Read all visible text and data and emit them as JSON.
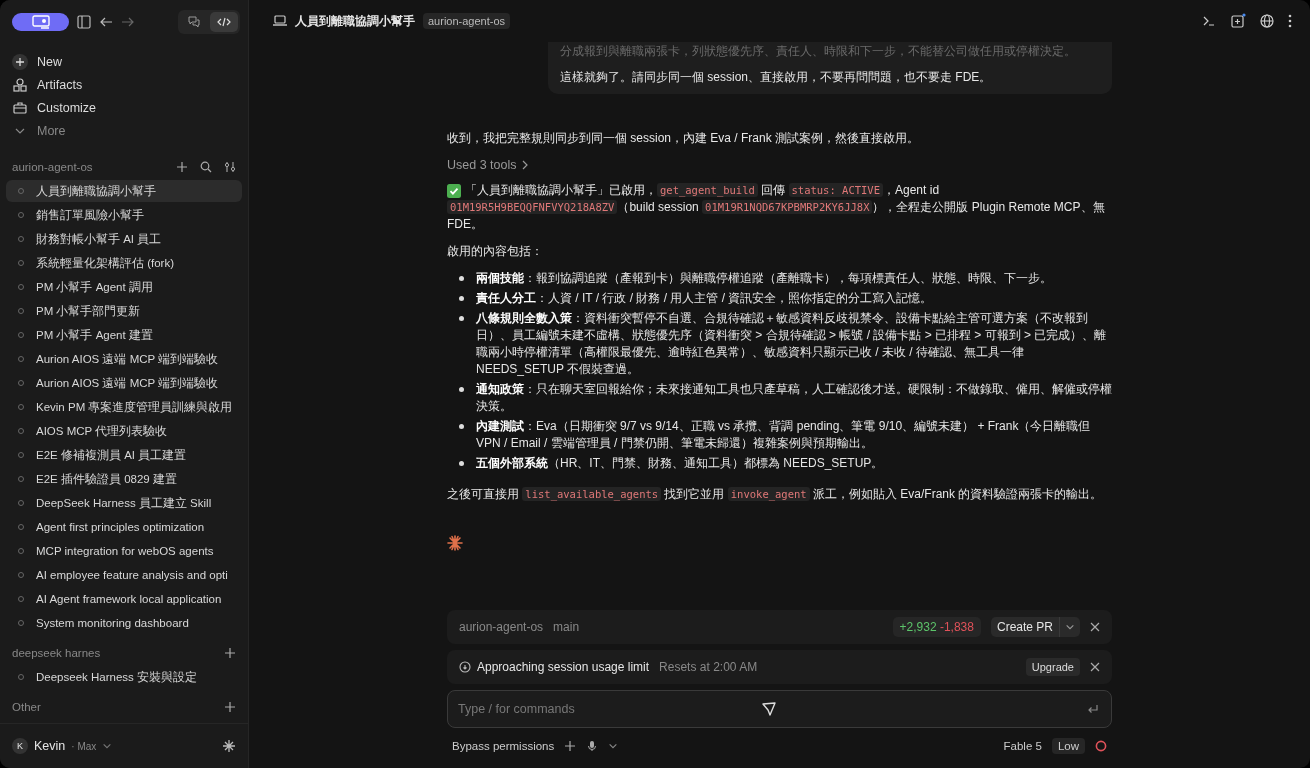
{
  "sidebar": {
    "nav": [
      {
        "kind": "new",
        "label": "New"
      },
      {
        "kind": "artifacts",
        "label": "Artifacts"
      },
      {
        "kind": "customize",
        "label": "Customize"
      },
      {
        "kind": "more",
        "label": "More"
      }
    ],
    "groups": [
      {
        "title": "aurion-agent-os",
        "tools": true,
        "items": [
          {
            "label": "人員到離職協調小幫手",
            "selected": true
          },
          {
            "label": "銷售訂單風險小幫手",
            "selected": false
          },
          {
            "label": "財務對帳小幫手 AI 員工",
            "selected": false
          },
          {
            "label": "系統輕量化架構評估 (fork)",
            "selected": false
          },
          {
            "label": "PM 小幫手 Agent 調用",
            "selected": false
          },
          {
            "label": "PM 小幫手部門更新",
            "selected": false
          },
          {
            "label": "PM 小幫手 Agent 建置",
            "selected": false
          },
          {
            "label": "Aurion AIOS 遠端 MCP 端到端驗收",
            "selected": false
          },
          {
            "label": "Aurion AIOS 遠端 MCP 端到端驗收",
            "selected": false
          },
          {
            "label": "Kevin PM 專案進度管理員訓練與啟用",
            "selected": false
          },
          {
            "label": "AIOS MCP 代理列表驗收",
            "selected": false
          },
          {
            "label": "E2E 修補複測員 AI 員工建置",
            "selected": false
          },
          {
            "label": "E2E 插件驗證員 0829 建置",
            "selected": false
          },
          {
            "label": "DeepSeek Harness 員工建立 Skill",
            "selected": false
          },
          {
            "label": "Agent first principles optimization",
            "selected": false
          },
          {
            "label": "MCP integration for webOS agents",
            "selected": false
          },
          {
            "label": "AI employee feature analysis and opti",
            "selected": false
          },
          {
            "label": "AI Agent framework local application",
            "selected": false
          },
          {
            "label": "System monitoring dashboard",
            "selected": false
          }
        ]
      },
      {
        "title": "deepseek harnes",
        "tools": false,
        "items": [
          {
            "label": "Deepseek Harness 安裝與設定",
            "selected": false
          }
        ]
      },
      {
        "title": "Other",
        "tools": false
      }
    ],
    "user": {
      "initial": "K",
      "name": "Kevin",
      "plan": "· Max"
    }
  },
  "header": {
    "title": "人員到離職協調小幫手",
    "project": "aurion-agent-os"
  },
  "user_message": [
    "分成報到與離職兩張卡，列狀態優先序、責任人、時限和下一步，不能替公司做任用或停權決定。",
    "這樣就夠了。請同步同一個 session、直接啟用，不要再問問題，也不要走 FDE。"
  ],
  "reply": {
    "intro": "收到，我把完整規則同步到同一個 session，內建 Eva / Frank 測試案例，然後直接啟用。",
    "tools_used": "Used 3 tools",
    "status": [
      {
        "kind": "text",
        "text": "「人員到離職協調小幫手」已啟用，"
      },
      {
        "kind": "code",
        "text": "get_agent_build"
      },
      {
        "kind": "text",
        "text": " 回傳 "
      },
      {
        "kind": "code",
        "text": "status: ACTIVE"
      },
      {
        "kind": "text",
        "text": "，Agent id "
      },
      {
        "kind": "code",
        "text": "01M19R5H9BEQQFNFVYQ218A8ZV"
      },
      {
        "kind": "text",
        "text": "（build session "
      },
      {
        "kind": "code",
        "text": "01M19R1NQD67KPBMRP2KY6JJ8X"
      },
      {
        "kind": "text",
        "text": "），全程走公開版 Plugin Remote MCP、無 FDE。"
      }
    ],
    "list_intro": "啟用的內容包括：",
    "bullets": [
      "**兩個技能**：報到協調追蹤（產報到卡）與離職停權追蹤（產離職卡），每項標責任人、狀態、時限、下一步。",
      "**責任人分工**：人資 / IT / 行政 / 財務 / 用人主管 / 資訊安全，照你指定的分工寫入記憶。",
      "**八條規則全數入策**：資料衝突暫停不自選、合規待確認＋敏感資料反歧視禁令、設備卡點給主管可選方案（不改報到日）、員工編號未建不虛構、狀態優先序（資料衝突 > 合規待確認 > 帳號 / 設備卡點 > 已排程 > 可報到 > 已完成）、離職兩小時停權清單（高權限最優先、逾時紅色異常）、敏感資料只顯示已收 / 未收 / 待確認、無工具一律 NEEDS_SETUP 不假裝查過。",
      "**通知政策**：只在聊天室回報給你；未來接通知工具也只產草稿，人工確認後才送。硬限制：不做錄取、僱用、解僱或停權決策。",
      "**內建測試**：Eva（日期衝突 9/7 vs 9/14、正職 vs 承攬、背調 pending、筆電 9/10、編號未建） + Frank（今日離職但 VPN / Email / 雲端管理員 / 門禁仍開、筆電未歸還）複雜案例與預期輸出。",
      "**五個外部系統**（HR、IT、門禁、財務、通知工具）都標為 NEEDS_SETUP。"
    ],
    "outro": [
      {
        "kind": "text",
        "text": "之後可直接用 "
      },
      {
        "kind": "code",
        "text": "list_available_agents"
      },
      {
        "kind": "text",
        "text": " 找到它並用 "
      },
      {
        "kind": "code",
        "text": "invoke_agent"
      },
      {
        "kind": "text",
        "text": " 派工，例如貼入 Eva/Frank 的資料驗證兩張卡的輸出。"
      }
    ]
  },
  "branch_bar": {
    "repo": "aurion-agent-os",
    "branch": "main",
    "added": "+2,932",
    "removed": "-1,838",
    "button": "Create PR"
  },
  "usage_bar": {
    "message": "Approaching session usage limit",
    "reset": "Resets at 2:00 AM",
    "button": "Upgrade"
  },
  "composer": {
    "placeholder": "Type / for commands",
    "permissions": "Bypass permissions",
    "model": "Fable 5",
    "effort": "Low"
  }
}
